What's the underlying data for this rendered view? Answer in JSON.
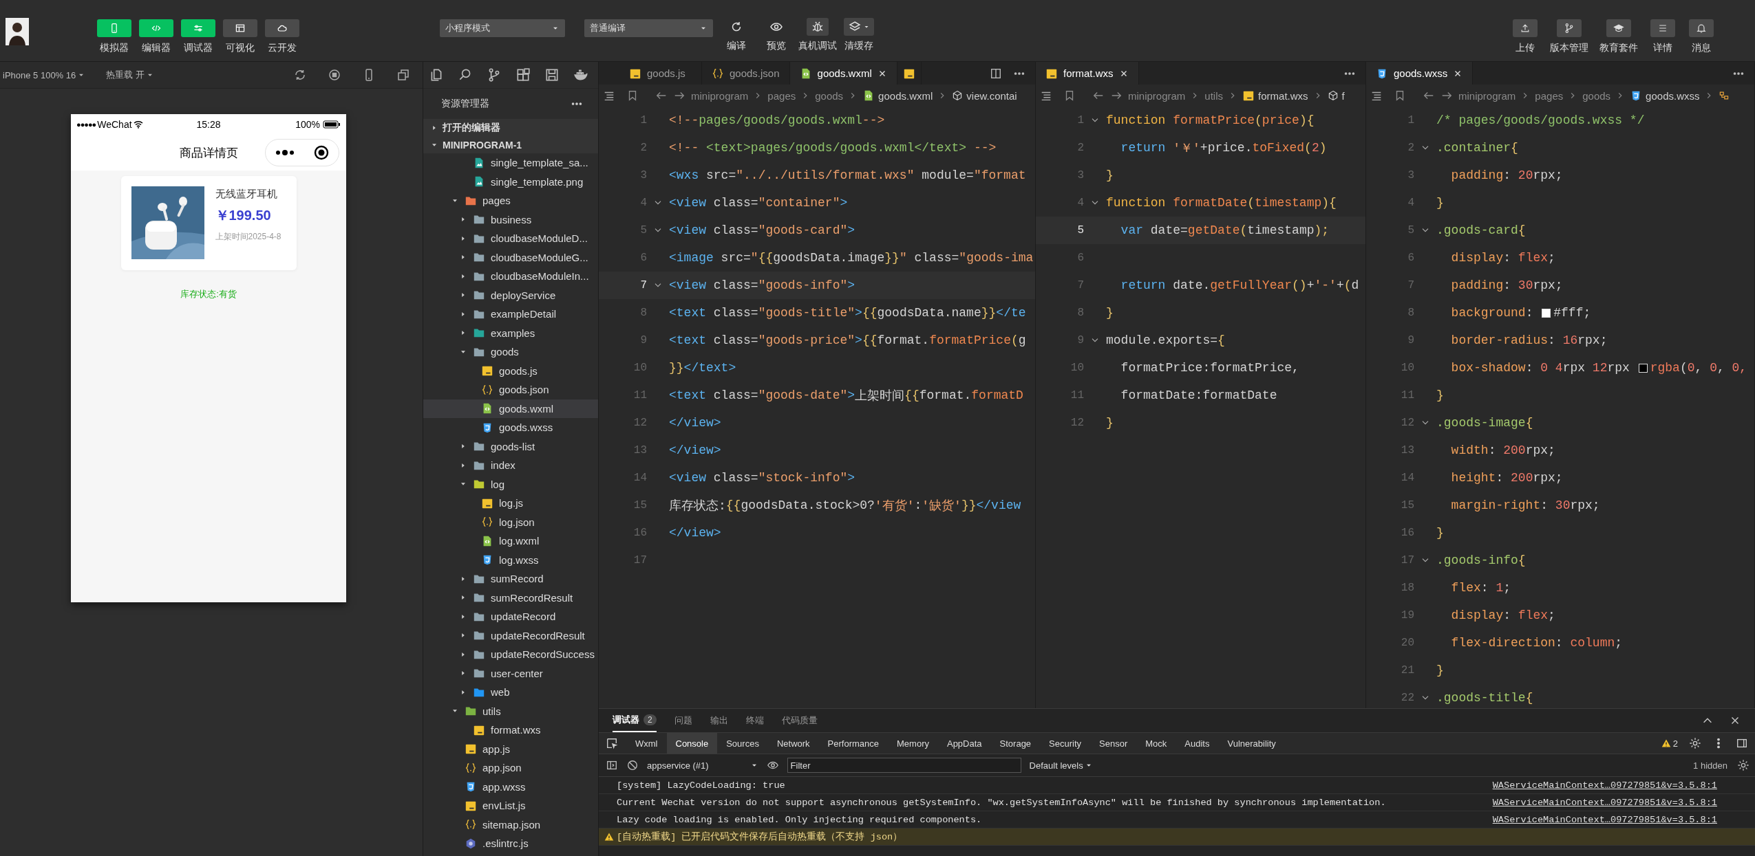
{
  "toolbar": {
    "left_buttons": [
      {
        "label": "模拟器",
        "on": true
      },
      {
        "label": "编辑器",
        "on": true
      },
      {
        "label": "调试器",
        "on": true
      },
      {
        "label": "可视化",
        "on": false
      },
      {
        "label": "云开发",
        "on": false
      }
    ],
    "mode_select": "小程序模式",
    "compile_select": "普通编译",
    "actions": [
      {
        "label": "编译"
      },
      {
        "label": "预览"
      },
      {
        "label": "真机调试"
      },
      {
        "label": "清缓存"
      }
    ],
    "right_buttons": [
      {
        "label": "上传"
      },
      {
        "label": "版本管理"
      },
      {
        "label": "教育套件"
      },
      {
        "label": "详情"
      },
      {
        "label": "消息"
      }
    ]
  },
  "simulator": {
    "device": "iPhone 5 100% 16",
    "hot_reload": "热重载 开",
    "phone": {
      "signal": "●●●●●",
      "carrier": "WeChat",
      "time": "15:28",
      "battery": "100%",
      "title": "商品详情页",
      "product": {
        "name": "无线蓝牙耳机",
        "price": "￥199.50",
        "date": "上架时间2025-4-8"
      },
      "stock": "库存状态:有货"
    }
  },
  "explorer": {
    "title": "资源管理器",
    "sections": [
      {
        "label": "打开的编辑器",
        "expanded": false
      },
      {
        "label": "MINIPROGRAM-1",
        "expanded": true
      }
    ],
    "continued_files": [
      {
        "label": "single_template_sa...",
        "kind": "png",
        "selected": false
      },
      {
        "label": "single_template.png",
        "kind": "png",
        "selected": false
      }
    ],
    "tree": [
      {
        "label": "pages",
        "kind": "folder-pages",
        "expanded": true,
        "selected": false,
        "children": [
          {
            "label": "business",
            "kind": "folder",
            "expanded": false,
            "selected": false
          },
          {
            "label": "cloudbaseModuleD...",
            "kind": "folder",
            "expanded": false,
            "selected": false
          },
          {
            "label": "cloudbaseModuleG...",
            "kind": "folder",
            "expanded": false,
            "selected": false
          },
          {
            "label": "cloudbaseModuleIn...",
            "kind": "folder",
            "expanded": false,
            "selected": false
          },
          {
            "label": "deployService",
            "kind": "folder",
            "expanded": false,
            "selected": false
          },
          {
            "label": "exampleDetail",
            "kind": "folder",
            "expanded": false,
            "selected": false
          },
          {
            "label": "examples",
            "kind": "folder-examples",
            "expanded": false,
            "selected": false
          },
          {
            "label": "goods",
            "kind": "folder",
            "expanded": true,
            "selected": false,
            "children": [
              {
                "label": "goods.js",
                "kind": "js",
                "selected": false
              },
              {
                "label": "goods.json",
                "kind": "json",
                "selected": false
              },
              {
                "label": "goods.wxml",
                "kind": "wxml",
                "selected": true
              },
              {
                "label": "goods.wxss",
                "kind": "wxss",
                "selected": false
              }
            ]
          },
          {
            "label": "goods-list",
            "kind": "folder",
            "expanded": false,
            "selected": false
          },
          {
            "label": "index",
            "kind": "folder",
            "expanded": false,
            "selected": false
          },
          {
            "label": "log",
            "kind": "folder-log",
            "expanded": true,
            "selected": false,
            "children": [
              {
                "label": "log.js",
                "kind": "js",
                "selected": false
              },
              {
                "label": "log.json",
                "kind": "json",
                "selected": false
              },
              {
                "label": "log.wxml",
                "kind": "wxml",
                "selected": false
              },
              {
                "label": "log.wxss",
                "kind": "wxss",
                "selected": false
              }
            ]
          },
          {
            "label": "sumRecord",
            "kind": "folder",
            "expanded": false,
            "selected": false
          },
          {
            "label": "sumRecordResult",
            "kind": "folder",
            "expanded": false,
            "selected": false
          },
          {
            "label": "updateRecord",
            "kind": "folder",
            "expanded": false,
            "selected": false
          },
          {
            "label": "updateRecordResult",
            "kind": "folder",
            "expanded": false,
            "selected": false
          },
          {
            "label": "updateRecordSuccess",
            "kind": "folder",
            "expanded": false,
            "selected": false
          },
          {
            "label": "user-center",
            "kind": "folder",
            "expanded": false,
            "selected": false
          },
          {
            "label": "web",
            "kind": "folder-web",
            "expanded": false,
            "selected": false
          }
        ]
      },
      {
        "label": "utils",
        "kind": "folder-utils",
        "expanded": true,
        "selected": false,
        "children": [
          {
            "label": "format.wxs",
            "kind": "js",
            "selected": false
          }
        ]
      },
      {
        "label": "app.js",
        "kind": "js",
        "selected": false
      },
      {
        "label": "app.json",
        "kind": "json",
        "selected": false
      },
      {
        "label": "app.wxss",
        "kind": "wxss",
        "selected": false
      },
      {
        "label": "envList.js",
        "kind": "js",
        "selected": false
      },
      {
        "label": "sitemap.json",
        "kind": "json",
        "selected": false
      },
      {
        "label": ".eslintrc.js",
        "kind": "eslint",
        "selected": false
      }
    ]
  },
  "editors": [
    {
      "tabs": [
        {
          "label": "goods.js",
          "kind": "js",
          "selected": false
        },
        {
          "label": "goods.json",
          "kind": "json",
          "selected": false
        },
        {
          "label": "goods.wxml",
          "kind": "wxml",
          "selected": true
        },
        {
          "kind": "js",
          "selected": false
        }
      ],
      "crumbs": [
        {
          "text": "miniprogram"
        },
        {
          "text": "pages"
        },
        {
          "text": "goods"
        },
        {
          "text": "goods.wxml",
          "kind": "wxml"
        },
        {
          "text": "view.contai",
          "kind": "symbol"
        }
      ],
      "lines": [
        {
          "n": "1",
          "current": false,
          "fold": false,
          "tokens": [
            {
              "text": "<!--",
              "kind": "cpunct"
            },
            {
              "text": "pages/goods/goods.wxml",
              "kind": "comment"
            },
            {
              "text": "-->",
              "kind": "cpunct"
            }
          ]
        },
        {
          "n": "2",
          "current": false,
          "fold": false,
          "tokens": [
            {
              "text": "<!-- ",
              "kind": "cpunct"
            },
            {
              "text": "<text>pages/goods/goods.wxml</text>",
              "kind": "comment"
            },
            {
              "text": " -->",
              "kind": "cpunct"
            }
          ]
        },
        {
          "n": "3",
          "current": false,
          "fold": false,
          "tokens": [
            {
              "text": "<wxs",
              "kind": "tag"
            },
            {
              "text": " src=",
              "kind": "attr"
            },
            {
              "text": "\"../../utils/format.wxs\"",
              "kind": "string"
            },
            {
              "text": " module=",
              "kind": "attr"
            },
            {
              "text": "\"format",
              "kind": "string"
            }
          ]
        },
        {
          "n": "4",
          "current": false,
          "fold": true,
          "tokens": [
            {
              "text": "<view",
              "kind": "tag"
            },
            {
              "text": " class=",
              "kind": "attr"
            },
            {
              "text": "\"container\"",
              "kind": "string"
            },
            {
              "text": ">",
              "kind": "tag"
            }
          ]
        },
        {
          "n": "5",
          "current": false,
          "fold": true,
          "tokens": [
            {
              "text": "<view",
              "kind": "tag"
            },
            {
              "text": " class=",
              "kind": "attr"
            },
            {
              "text": "\"goods-card\"",
              "kind": "string"
            },
            {
              "text": ">",
              "kind": "tag"
            }
          ]
        },
        {
          "n": "6",
          "current": false,
          "fold": false,
          "tokens": [
            {
              "text": "<image",
              "kind": "tag"
            },
            {
              "text": " src=",
              "kind": "attr"
            },
            {
              "text": "\"",
              "kind": "string"
            },
            {
              "text": "{{",
              "kind": "brace"
            },
            {
              "text": "goodsData.image",
              "kind": "plain"
            },
            {
              "text": "}}",
              "kind": "brace"
            },
            {
              "text": "\"",
              "kind": "string"
            },
            {
              "text": " class=",
              "kind": "attr"
            },
            {
              "text": "\"goods-ima",
              "kind": "string"
            }
          ]
        },
        {
          "n": "7",
          "current": true,
          "fold": true,
          "tokens": [
            {
              "text": "<view",
              "kind": "tag"
            },
            {
              "text": " class=",
              "kind": "attr"
            },
            {
              "text": "\"goods-info\"",
              "kind": "string"
            },
            {
              "text": ">",
              "kind": "tag"
            }
          ]
        },
        {
          "n": "8",
          "current": false,
          "fold": false,
          "tokens": [
            {
              "text": "<text",
              "kind": "tag"
            },
            {
              "text": " class=",
              "kind": "attr"
            },
            {
              "text": "\"goods-title\"",
              "kind": "string"
            },
            {
              "text": ">",
              "kind": "tag"
            },
            {
              "text": "{{",
              "kind": "brace"
            },
            {
              "text": "goodsData.name",
              "kind": "plain"
            },
            {
              "text": "}}",
              "kind": "brace"
            },
            {
              "text": "</te",
              "kind": "tag"
            }
          ]
        },
        {
          "n": "9",
          "current": false,
          "fold": false,
          "tokens": [
            {
              "text": "<text",
              "kind": "tag"
            },
            {
              "text": " class=",
              "kind": "attr"
            },
            {
              "text": "\"goods-price\"",
              "kind": "string"
            },
            {
              "text": ">",
              "kind": "tag"
            },
            {
              "text": "{{",
              "kind": "brace"
            },
            {
              "text": "format.",
              "kind": "plain"
            },
            {
              "text": "formatPrice",
              "kind": "func"
            },
            {
              "text": "(",
              "kind": "brace"
            },
            {
              "text": "g",
              "kind": "plain"
            }
          ]
        },
        {
          "n": "10",
          "current": false,
          "fold": false,
          "tokens": [
            {
              "text": "}}",
              "kind": "brace"
            },
            {
              "text": "</text>",
              "kind": "tag"
            }
          ]
        },
        {
          "n": "11",
          "current": false,
          "fold": false,
          "tokens": [
            {
              "text": "<text",
              "kind": "tag"
            },
            {
              "text": " class=",
              "kind": "attr"
            },
            {
              "text": "\"goods-date\"",
              "kind": "string"
            },
            {
              "text": ">",
              "kind": "tag"
            },
            {
              "text": "上架时间",
              "kind": "plain"
            },
            {
              "text": "{{",
              "kind": "brace"
            },
            {
              "text": "format.",
              "kind": "plain"
            },
            {
              "text": "formatD",
              "kind": "func"
            }
          ]
        },
        {
          "n": "12",
          "current": false,
          "fold": false,
          "tokens": [
            {
              "text": "</view>",
              "kind": "tag"
            }
          ]
        },
        {
          "n": "13",
          "current": false,
          "fold": false,
          "tokens": [
            {
              "text": "</view>",
              "kind": "tag"
            }
          ]
        },
        {
          "n": "14",
          "current": false,
          "fold": false,
          "tokens": [
            {
              "text": "<view",
              "kind": "tag"
            },
            {
              "text": " class=",
              "kind": "attr"
            },
            {
              "text": "\"stock-info\"",
              "kind": "string"
            },
            {
              "text": ">",
              "kind": "tag"
            }
          ]
        },
        {
          "n": "15",
          "current": false,
          "fold": false,
          "tokens": [
            {
              "text": "库存状态:",
              "kind": "plain"
            },
            {
              "text": "{{",
              "kind": "brace"
            },
            {
              "text": "goodsData.stock>0?",
              "kind": "plain"
            },
            {
              "text": "'有货'",
              "kind": "string"
            },
            {
              "text": ":",
              "kind": "plain"
            },
            {
              "text": "'缺货'",
              "kind": "string"
            },
            {
              "text": "}}",
              "kind": "brace"
            },
            {
              "text": "</view",
              "kind": "tag"
            }
          ]
        },
        {
          "n": "16",
          "current": false,
          "fold": false,
          "tokens": [
            {
              "text": "</view>",
              "kind": "tag"
            }
          ]
        },
        {
          "n": "17",
          "current": false,
          "fold": false
        }
      ]
    },
    {
      "tabs": [
        {
          "label": "format.wxs",
          "kind": "js",
          "selected": true
        }
      ],
      "crumbs": [
        {
          "text": "miniprogram"
        },
        {
          "text": "utils"
        },
        {
          "text": "format.wxs",
          "kind": "js"
        },
        {
          "text": "f",
          "kind": "symbol"
        }
      ],
      "lines": [
        {
          "n": "1",
          "current": false,
          "fold": true,
          "tokens": [
            {
              "text": "function",
              "kind": "keyword"
            },
            {
              "text": " formatPrice",
              "kind": "func"
            },
            {
              "text": "(",
              "kind": "brace"
            },
            {
              "text": "price",
              "kind": "func"
            },
            {
              "text": "){",
              "kind": "brace"
            }
          ]
        },
        {
          "n": "2",
          "current": false,
          "fold": false,
          "tokens": [
            {
              "text": "  return",
              "kind": "control"
            },
            {
              "text": " '￥'",
              "kind": "string"
            },
            {
              "text": "+price.",
              "kind": "plain"
            },
            {
              "text": "toFixed",
              "kind": "func"
            },
            {
              "text": "(",
              "kind": "brace"
            },
            {
              "text": "2",
              "kind": "number"
            },
            {
              "text": ")",
              "kind": "brace"
            }
          ]
        },
        {
          "n": "3",
          "current": false,
          "fold": false,
          "tokens": [
            {
              "text": "}",
              "kind": "brace"
            }
          ]
        },
        {
          "n": "4",
          "current": false,
          "fold": true,
          "tokens": [
            {
              "text": "function",
              "kind": "keyword"
            },
            {
              "text": " formatDate",
              "kind": "func"
            },
            {
              "text": "(",
              "kind": "brace"
            },
            {
              "text": "timestamp",
              "kind": "func"
            },
            {
              "text": "){",
              "kind": "brace"
            }
          ]
        },
        {
          "n": "5",
          "current": true,
          "fold": false,
          "tokens": [
            {
              "text": "  var",
              "kind": "control"
            },
            {
              "text": " date=",
              "kind": "plain"
            },
            {
              "text": "getDate",
              "kind": "func"
            },
            {
              "text": "(",
              "kind": "brace"
            },
            {
              "text": "timestamp",
              "kind": "plain"
            },
            {
              "text": ");",
              "kind": "brace"
            }
          ]
        },
        {
          "n": "6",
          "current": false,
          "fold": false
        },
        {
          "n": "7",
          "current": false,
          "fold": false,
          "tokens": [
            {
              "text": "  return",
              "kind": "control"
            },
            {
              "text": " date.",
              "kind": "plain"
            },
            {
              "text": "getFullYear",
              "kind": "func"
            },
            {
              "text": "()",
              "kind": "brace"
            },
            {
              "text": "+",
              "kind": "plain"
            },
            {
              "text": "'-'",
              "kind": "string"
            },
            {
              "text": "+",
              "kind": "plain"
            },
            {
              "text": "(",
              "kind": "brace"
            },
            {
              "text": "d",
              "kind": "plain"
            }
          ]
        },
        {
          "n": "8",
          "current": false,
          "fold": false,
          "tokens": [
            {
              "text": "}",
              "kind": "brace"
            }
          ]
        },
        {
          "n": "9",
          "current": false,
          "fold": true,
          "tokens": [
            {
              "text": "module.exports=",
              "kind": "plain"
            },
            {
              "text": "{",
              "kind": "brace"
            }
          ]
        },
        {
          "n": "10",
          "current": false,
          "fold": false,
          "tokens": [
            {
              "text": "  formatPrice:formatPrice,",
              "kind": "plain"
            }
          ]
        },
        {
          "n": "11",
          "current": false,
          "fold": false,
          "tokens": [
            {
              "text": "  formatDate:formatDate",
              "kind": "plain"
            }
          ]
        },
        {
          "n": "12",
          "current": false,
          "fold": false,
          "tokens": [
            {
              "text": "}",
              "kind": "brace"
            }
          ]
        }
      ]
    },
    {
      "tabs": [
        {
          "label": "goods.wxss",
          "kind": "wxss",
          "selected": true
        }
      ],
      "crumbs": [
        {
          "text": "miniprogram"
        },
        {
          "text": "pages"
        },
        {
          "text": "goods"
        },
        {
          "text": "goods.wxss",
          "kind": "wxss"
        },
        {
          "kind": "selector"
        }
      ],
      "lines": [
        {
          "n": "1",
          "current": false,
          "fold": false,
          "tokens": [
            {
              "text": "/* pages/goods/goods.wxss */",
              "kind": "comment"
            }
          ]
        },
        {
          "n": "2",
          "current": false,
          "fold": true,
          "tokens": [
            {
              "text": ".container",
              "kind": "selector"
            },
            {
              "text": "{",
              "kind": "brace"
            }
          ]
        },
        {
          "n": "3",
          "current": false,
          "fold": false,
          "tokens": [
            {
              "text": "  padding",
              "kind": "prop"
            },
            {
              "text": ": ",
              "kind": "plain"
            },
            {
              "text": "20",
              "kind": "number"
            },
            {
              "text": "rpx;",
              "kind": "plain"
            }
          ]
        },
        {
          "n": "4",
          "current": false,
          "fold": false,
          "tokens": [
            {
              "text": "}",
              "kind": "brace"
            }
          ]
        },
        {
          "n": "5",
          "current": false,
          "fold": true,
          "tokens": [
            {
              "text": ".goods-card",
              "kind": "selector"
            },
            {
              "text": "{",
              "kind": "brace"
            }
          ]
        },
        {
          "n": "6",
          "current": false,
          "fold": false,
          "tokens": [
            {
              "text": "  display",
              "kind": "prop"
            },
            {
              "text": ": ",
              "kind": "plain"
            },
            {
              "text": "flex",
              "kind": "value"
            },
            {
              "text": ";",
              "kind": "plain"
            }
          ]
        },
        {
          "n": "7",
          "current": false,
          "fold": false,
          "tokens": [
            {
              "text": "  padding",
              "kind": "prop"
            },
            {
              "text": ": ",
              "kind": "plain"
            },
            {
              "text": "30",
              "kind": "number"
            },
            {
              "text": "rpx;",
              "kind": "plain"
            }
          ]
        },
        {
          "n": "8",
          "current": false,
          "fold": false,
          "tokens": [
            {
              "text": "  background",
              "kind": "prop"
            },
            {
              "text": ": ",
              "kind": "plain"
            },
            {
              "kind": "swatch",
              "color": "#ffffff"
            },
            {
              "text": "#fff;",
              "kind": "plain"
            }
          ]
        },
        {
          "n": "9",
          "current": false,
          "fold": false,
          "tokens": [
            {
              "text": "  border-radius",
              "kind": "prop"
            },
            {
              "text": ": ",
              "kind": "plain"
            },
            {
              "text": "16",
              "kind": "number"
            },
            {
              "text": "rpx;",
              "kind": "plain"
            }
          ]
        },
        {
          "n": "10",
          "current": false,
          "fold": false,
          "tokens": [
            {
              "text": "  box-shadow",
              "kind": "prop"
            },
            {
              "text": ": ",
              "kind": "plain"
            },
            {
              "text": "0 4",
              "kind": "number"
            },
            {
              "text": "rpx ",
              "kind": "plain"
            },
            {
              "text": "12",
              "kind": "number"
            },
            {
              "text": "rpx ",
              "kind": "plain"
            },
            {
              "kind": "swatch",
              "color": "#000000"
            },
            {
              "text": "rgba",
              "kind": "value"
            },
            {
              "text": "(",
              "kind": "plain"
            },
            {
              "text": "0",
              "kind": "number"
            },
            {
              "text": ", ",
              "kind": "plain"
            },
            {
              "text": "0",
              "kind": "number"
            },
            {
              "text": ", ",
              "kind": "plain"
            },
            {
              "text": "0,",
              "kind": "number"
            }
          ]
        },
        {
          "n": "11",
          "current": false,
          "fold": false,
          "tokens": [
            {
              "text": "}",
              "kind": "brace"
            }
          ]
        },
        {
          "n": "12",
          "current": false,
          "fold": true,
          "tokens": [
            {
              "text": ".goods-image",
              "kind": "selector"
            },
            {
              "text": "{",
              "kind": "brace"
            }
          ]
        },
        {
          "n": "13",
          "current": false,
          "fold": false,
          "tokens": [
            {
              "text": "  width",
              "kind": "prop"
            },
            {
              "text": ": ",
              "kind": "plain"
            },
            {
              "text": "200",
              "kind": "number"
            },
            {
              "text": "rpx;",
              "kind": "plain"
            }
          ]
        },
        {
          "n": "14",
          "current": false,
          "fold": false,
          "tokens": [
            {
              "text": "  height",
              "kind": "prop"
            },
            {
              "text": ": ",
              "kind": "plain"
            },
            {
              "text": "200",
              "kind": "number"
            },
            {
              "text": "rpx;",
              "kind": "plain"
            }
          ]
        },
        {
          "n": "15",
          "current": false,
          "fold": false,
          "tokens": [
            {
              "text": "  margin-right",
              "kind": "prop"
            },
            {
              "text": ": ",
              "kind": "plain"
            },
            {
              "text": "30",
              "kind": "number"
            },
            {
              "text": "rpx;",
              "kind": "plain"
            }
          ]
        },
        {
          "n": "16",
          "current": false,
          "fold": false,
          "tokens": [
            {
              "text": "}",
              "kind": "brace"
            }
          ]
        },
        {
          "n": "17",
          "current": false,
          "fold": true,
          "tokens": [
            {
              "text": ".goods-info",
              "kind": "selector"
            },
            {
              "text": "{",
              "kind": "brace"
            }
          ]
        },
        {
          "n": "18",
          "current": false,
          "fold": false,
          "tokens": [
            {
              "text": "  flex",
              "kind": "prop"
            },
            {
              "text": ": ",
              "kind": "plain"
            },
            {
              "text": "1",
              "kind": "number"
            },
            {
              "text": ";",
              "kind": "plain"
            }
          ]
        },
        {
          "n": "19",
          "current": false,
          "fold": false,
          "tokens": [
            {
              "text": "  display",
              "kind": "prop"
            },
            {
              "text": ": ",
              "kind": "plain"
            },
            {
              "text": "flex",
              "kind": "value"
            },
            {
              "text": ";",
              "kind": "plain"
            }
          ]
        },
        {
          "n": "20",
          "current": false,
          "fold": false,
          "tokens": [
            {
              "text": "  flex-direction",
              "kind": "prop"
            },
            {
              "text": ": ",
              "kind": "plain"
            },
            {
              "text": "column",
              "kind": "value"
            },
            {
              "text": ";",
              "kind": "plain"
            }
          ]
        },
        {
          "n": "21",
          "current": false,
          "fold": false,
          "tokens": [
            {
              "text": "}",
              "kind": "brace"
            }
          ]
        },
        {
          "n": "22",
          "current": false,
          "fold": true,
          "tokens": [
            {
              "text": ".goods-title",
              "kind": "selector"
            },
            {
              "text": "{",
              "kind": "brace"
            }
          ]
        }
      ]
    }
  ],
  "devtools": {
    "panel_tabs": [
      {
        "label": "调试器",
        "badge": "2",
        "selected": true
      },
      {
        "label": "问题",
        "selected": false
      },
      {
        "label": "输出",
        "selected": false
      },
      {
        "label": "终端",
        "selected": false
      },
      {
        "label": "代码质量",
        "selected": false
      }
    ],
    "tool_tabs": [
      {
        "label": "Wxml",
        "selected": false
      },
      {
        "label": "Console",
        "selected": true
      },
      {
        "label": "Sources",
        "selected": false
      },
      {
        "label": "Network",
        "selected": false
      },
      {
        "label": "Performance",
        "selected": false
      },
      {
        "label": "Memory",
        "selected": false
      },
      {
        "label": "AppData",
        "selected": false
      },
      {
        "label": "Storage",
        "selected": false
      },
      {
        "label": "Security",
        "selected": false
      },
      {
        "label": "Sensor",
        "selected": false
      },
      {
        "label": "Mock",
        "selected": false
      },
      {
        "label": "Audits",
        "selected": false
      },
      {
        "label": "Vulnerability",
        "selected": false
      }
    ],
    "warnings": "2",
    "context": "appservice (#1)",
    "filter_placeholder": "Filter",
    "levels": "Default levels",
    "hidden": "1 hidden",
    "messages": [
      {
        "kind": "info",
        "text": "[system] LazyCodeLoading: true",
        "source": "WAServiceMainContext…097279851&v=3.5.8:1"
      },
      {
        "kind": "info",
        "text": "Current Wechat version do not support asynchronous getSystemInfo. \"wx.getSystemInfoAsync\" will be finished by synchronous implementation.",
        "source": "WAServiceMainContext…097279851&v=3.5.8:1"
      },
      {
        "kind": "info",
        "text": "Lazy code loading is enabled. Only injecting required components.",
        "source": "WAServiceMainContext…097279851&v=3.5.8:1"
      },
      {
        "kind": "warning",
        "text": "[自动热重载] 已开启代码文件保存后自动热重载（不支持 json）"
      }
    ]
  }
}
